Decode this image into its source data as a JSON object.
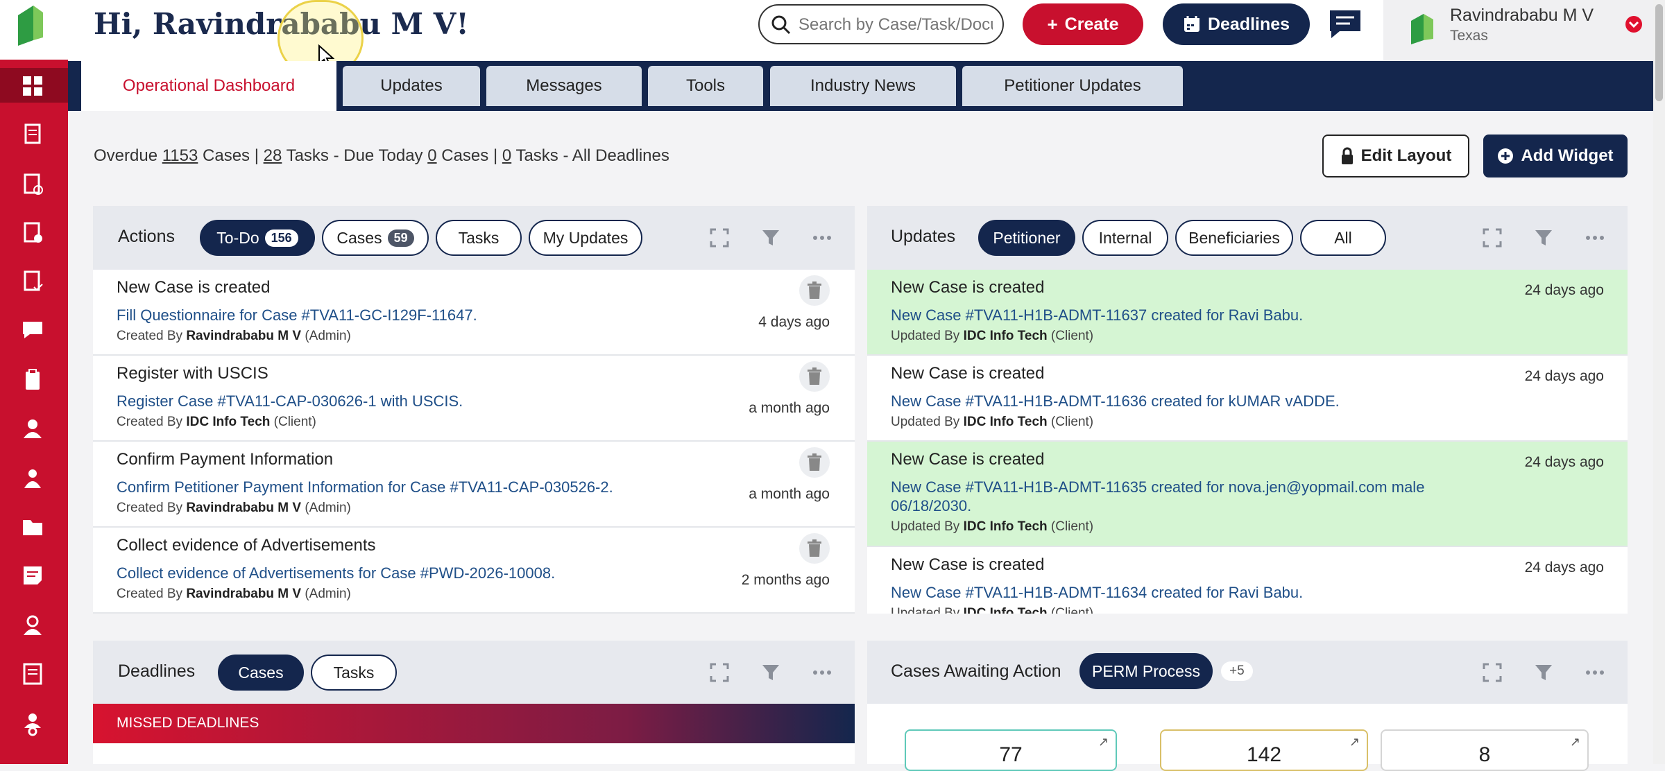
{
  "header": {
    "greeting": "Hi, Ravindrababu M V!",
    "search_placeholder": "Search by Case/Task/Document",
    "create_label": "Create",
    "deadlines_label": "Deadlines",
    "user_name": "Ravindrababu M V",
    "user_location": "Texas"
  },
  "tabs": [
    "Operational Dashboard",
    "Updates",
    "Messages",
    "Tools",
    "Industry News",
    "Petitioner Updates"
  ],
  "summary": {
    "overdue_label": "Overdue",
    "overdue_cases": "1153",
    "cases_label": "Cases |",
    "overdue_tasks": "28",
    "tasks_due_label": "Tasks - Due Today",
    "today_cases": "0",
    "cases_label2": "Cases |",
    "today_tasks": "0",
    "tasks_all_label": "Tasks - All Deadlines"
  },
  "toolbar": {
    "edit_layout": "Edit Layout",
    "add_widget": "Add Widget"
  },
  "actions": {
    "title": "Actions",
    "filters": [
      {
        "label": "To-Do",
        "count": "156"
      },
      {
        "label": "Cases",
        "count": "59"
      },
      {
        "label": "Tasks"
      },
      {
        "label": "My Updates"
      }
    ],
    "items": [
      {
        "title": "New Case is created",
        "desc": "Fill Questionnaire for Case #TVA11-GC-I129F-11647.",
        "by_label": "Created By",
        "by": "Ravindrababu M V",
        "role": "(Admin)",
        "time": "4 days ago"
      },
      {
        "title": "Register with USCIS",
        "desc": "Register Case #TVA11-CAP-030626-1 with USCIS.",
        "by_label": "Created By",
        "by": "IDC Info Tech",
        "role": "(Client)",
        "time": "a month ago"
      },
      {
        "title": "Confirm Payment Information",
        "desc": "Confirm Petitioner Payment Information for Case #TVA11-CAP-030526-2.",
        "by_label": "Created By",
        "by": "Ravindrababu M V",
        "role": "(Admin)",
        "time": "a month ago"
      },
      {
        "title": "Collect evidence of Advertisements",
        "desc": "Collect evidence of Advertisements for Case #PWD-2026-10008.",
        "by_label": "Created By",
        "by": "Ravindrababu M V",
        "role": "(Admin)",
        "time": "2 months ago"
      }
    ]
  },
  "updates": {
    "title": "Updates",
    "filters": [
      "Petitioner",
      "Internal",
      "Beneficiaries",
      "All"
    ],
    "items": [
      {
        "title": "New Case is created",
        "desc": "New Case #TVA11-H1B-ADMT-11637 created for Ravi Babu.",
        "desc2": "",
        "by_label": "Updated By",
        "by": "IDC Info Tech",
        "role": "(Client)",
        "time": "24 days ago"
      },
      {
        "title": "New Case is created",
        "desc": "New Case #TVA11-H1B-ADMT-11636 created for kUMAR vADDE.",
        "desc2": "",
        "by_label": "Updated By",
        "by": "IDC Info Tech",
        "role": "(Client)",
        "time": "24 days ago"
      },
      {
        "title": "New Case is created",
        "desc": "New Case #TVA11-H1B-ADMT-11635 created for nova.jen@yopmail.com male",
        "desc2": "06/18/2030.",
        "by_label": "Updated By",
        "by": "IDC Info Tech",
        "role": "(Client)",
        "time": "24 days ago"
      },
      {
        "title": "New Case is created",
        "desc": "New Case #TVA11-H1B-ADMT-11634 created for Ravi Babu.",
        "desc2": "",
        "by_label": "Updated By",
        "by": "IDC Info Tech",
        "role": "(Client)",
        "time": "24 days ago"
      }
    ]
  },
  "deadlines": {
    "title": "Deadlines",
    "filters": [
      "Cases",
      "Tasks"
    ],
    "missed_label": "MISSED DEADLINES"
  },
  "awaiting": {
    "title": "Cases Awaiting Action",
    "filter": "PERM Process",
    "more": "+5",
    "stats": [
      "77",
      "142",
      "8"
    ]
  },
  "colors": {
    "brand_red": "#c8102e",
    "navy": "#14264d",
    "highlight_green": "#d5f5d3"
  }
}
